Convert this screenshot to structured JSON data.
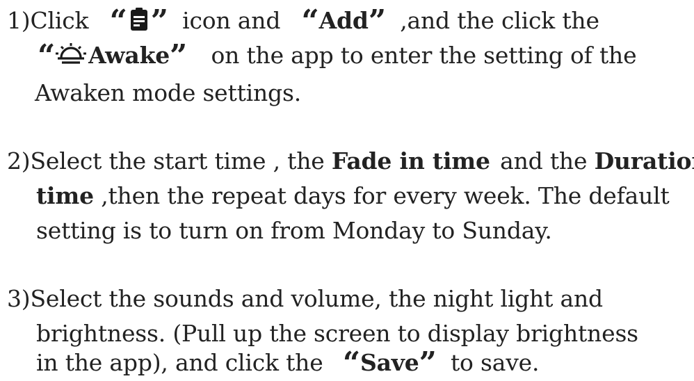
{
  "instructions": {
    "step1": {
      "number": "1)",
      "line1_a": "Click",
      "open_quote": "“",
      "close_quote": "”",
      "icon": "clipboard-icon",
      "line1_b": "icon and",
      "add_label": "Add",
      "line1_c": ",and the click the",
      "awake_icon": "sun-rising-icon",
      "awake_label": "Awake",
      "line2_b": "on the app to enter the setting of the",
      "line3": "Awaken mode settings."
    },
    "step2": {
      "number": "2)",
      "line1_a": "Select the start time , the",
      "fade_label": "Fade in time",
      "line1_b": "and the",
      "duration_label": "Duration",
      "time_label": "time",
      "line2_b": ",then the repeat days for every  week. The default",
      "line3": "setting is to turn on from Monday to Sunday."
    },
    "step3": {
      "number": "3)",
      "line1": "Select the sounds and volume, the night light and",
      "line2": "brightness. (Pull up the screen to display brightness",
      "line3_a": "in the app), and click the",
      "save_label": "Save",
      "line3_b": "to save."
    }
  },
  "colors": {
    "text": "#222222",
    "icon": "#1a1a1a"
  }
}
